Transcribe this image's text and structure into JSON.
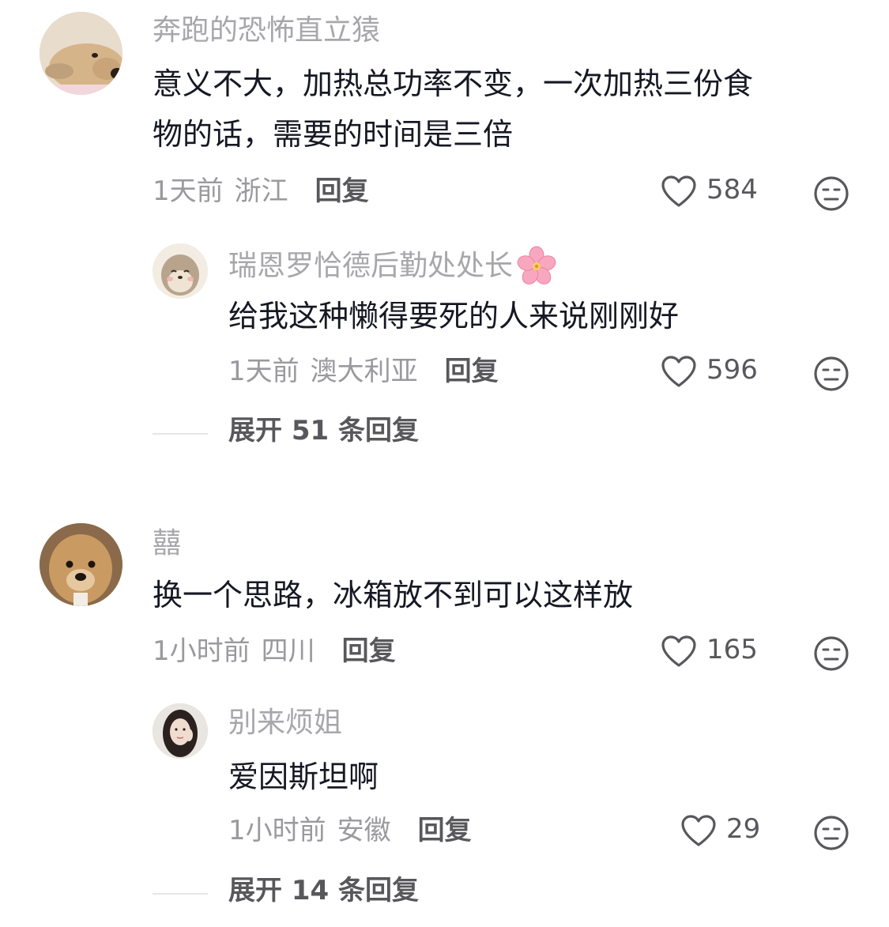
{
  "comments": [
    {
      "username": "奔跑的恐怖直立猿",
      "text_line1": "意义不大，加热总功率不变，一次加热三份食",
      "text_line2": "物的话，需要的时间是三倍",
      "time": "1天前",
      "location": "浙江",
      "reply_label": "回复",
      "likes": "584",
      "avatar_icon": "dog-avatar",
      "reply": {
        "username": "瑞恩罗恰德后勤处处长",
        "username_emoji": "🌸",
        "text": "给我这种懒得要死的人来说刚刚好",
        "time": "1天前",
        "location": "澳大利亚",
        "reply_label": "回复",
        "likes": "596",
        "avatar_icon": "otter-avatar"
      },
      "expand_label": "展开 51 条回复"
    },
    {
      "username": "囍",
      "text": "换一个思路，冰箱放不到可以这样放",
      "time": "1小时前",
      "location": "四川",
      "reply_label": "回复",
      "likes": "165",
      "avatar_icon": "dog-avatar",
      "reply": {
        "username": "别来烦姐",
        "text": "爱因斯坦啊",
        "time": "1小时前",
        "location": "安徽",
        "reply_label": "回复",
        "likes": "29",
        "avatar_icon": "girl-avatar"
      },
      "expand_label": "展开 14 条回复"
    }
  ],
  "colors": {
    "background": "#ffffff",
    "text": "#161823",
    "username": "#a7a7ab",
    "meta": "#9a9a9e",
    "action": "#58585c"
  }
}
